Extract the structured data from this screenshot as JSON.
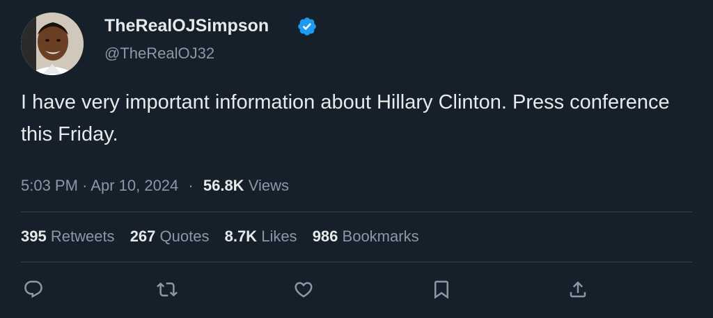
{
  "author": {
    "display_name": "TheRealOJSimpson",
    "handle": "@TheRealOJ32",
    "verified": true,
    "accent_color": "#1d9bf0"
  },
  "tweet": {
    "text": "I have very important information about Hillary Clinton. Press conference this Friday."
  },
  "meta": {
    "time": "5:03 PM",
    "separator": "·",
    "date": "Apr 10, 2024",
    "views_count": "56.8K",
    "views_label": "Views"
  },
  "stats": {
    "retweets": {
      "count": "395",
      "label": "Retweets"
    },
    "quotes": {
      "count": "267",
      "label": "Quotes"
    },
    "likes": {
      "count": "8.7K",
      "label": "Likes"
    },
    "bookmarks": {
      "count": "986",
      "label": "Bookmarks"
    }
  },
  "actions": [
    "reply-icon",
    "retweet-icon",
    "like-icon",
    "bookmark-icon",
    "share-icon"
  ],
  "colors": {
    "background": "#15202b",
    "text_primary": "#e7e9ea",
    "text_secondary": "#8b98a5",
    "divider": "#38444d"
  }
}
